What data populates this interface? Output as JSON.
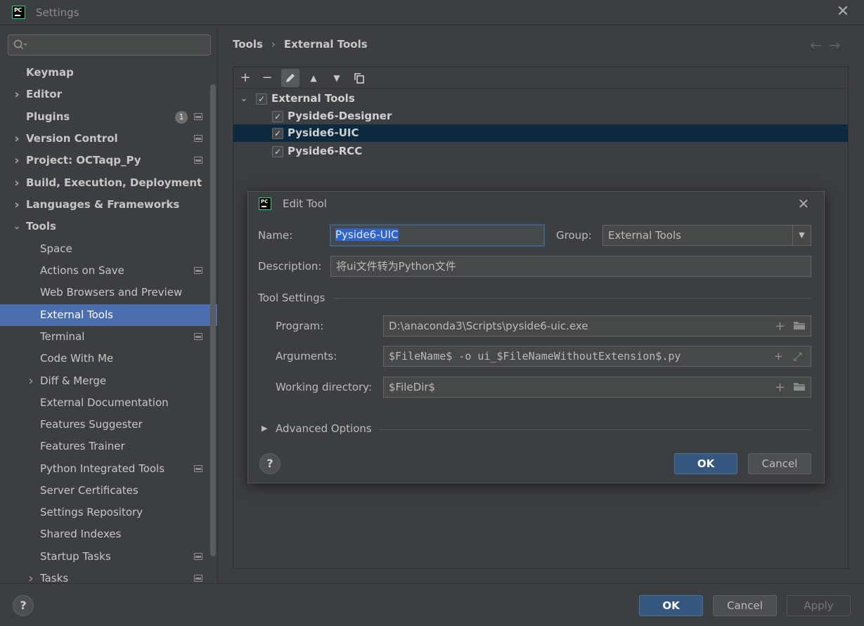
{
  "window": {
    "title": "Settings",
    "close_icon": "close-icon"
  },
  "sidebar": {
    "search": {
      "placeholder": "",
      "value": ""
    },
    "items": [
      {
        "label": "Keymap",
        "level": 0,
        "expandable": false
      },
      {
        "label": "Editor",
        "level": 0,
        "expandable": true,
        "expanded": false
      },
      {
        "label": "Plugins",
        "level": 0,
        "expandable": false,
        "badge": "1"
      },
      {
        "label": "Version Control",
        "level": 0,
        "expandable": true,
        "expanded": false
      },
      {
        "label": "Project: OCTaqp_Py",
        "level": 0,
        "expandable": true,
        "expanded": false
      },
      {
        "label": "Build, Execution, Deployment",
        "level": 0,
        "expandable": true,
        "expanded": false
      },
      {
        "label": "Languages & Frameworks",
        "level": 0,
        "expandable": true,
        "expanded": false
      },
      {
        "label": "Tools",
        "level": 0,
        "expandable": true,
        "expanded": true
      },
      {
        "label": "Space",
        "level": 1
      },
      {
        "label": "Actions on Save",
        "level": 1
      },
      {
        "label": "Web Browsers and Preview",
        "level": 1
      },
      {
        "label": "External Tools",
        "level": 1,
        "selected": true
      },
      {
        "label": "Terminal",
        "level": 1
      },
      {
        "label": "Code With Me",
        "level": 1
      },
      {
        "label": "Diff & Merge",
        "level": 1,
        "expandable": true
      },
      {
        "label": "External Documentation",
        "level": 1
      },
      {
        "label": "Features Suggester",
        "level": 1
      },
      {
        "label": "Features Trainer",
        "level": 1
      },
      {
        "label": "Python Integrated Tools",
        "level": 1
      },
      {
        "label": "Server Certificates",
        "level": 1
      },
      {
        "label": "Settings Repository",
        "level": 1
      },
      {
        "label": "Shared Indexes",
        "level": 1
      },
      {
        "label": "Startup Tasks",
        "level": 1
      },
      {
        "label": "Tasks",
        "level": 1,
        "expandable": true
      }
    ]
  },
  "breadcrumb": {
    "parent": "Tools",
    "separator": "›",
    "current": "External Tools"
  },
  "nav": {
    "back_icon": "back-arrow-icon",
    "forward_icon": "forward-arrow-icon"
  },
  "toolbar": {
    "buttons": [
      "add-icon",
      "remove-icon",
      "edit-icon",
      "move-up-icon",
      "move-down-icon",
      "copy-icon"
    ]
  },
  "tools_tree": {
    "group": {
      "label": "External Tools",
      "checked": true,
      "expanded": true
    },
    "items": [
      {
        "label": "Pyside6-Designer",
        "checked": true,
        "selected": false
      },
      {
        "label": "Pyside6-UIC",
        "checked": true,
        "selected": true
      },
      {
        "label": "Pyside6-RCC",
        "checked": true,
        "selected": false
      }
    ]
  },
  "edit_tool": {
    "title": "Edit Tool",
    "name_label": "Name:",
    "name_value": "Pyside6-UIC",
    "group_label": "Group:",
    "group_value": "External Tools",
    "description_label": "Description:",
    "description_value": "将ui文件转为Python文件",
    "tool_settings_label": "Tool Settings",
    "program_label": "Program:",
    "program_value": "D:\\anaconda3\\Scripts\\pyside6-uic.exe",
    "arguments_label": "Arguments:",
    "arguments_value": "$FileName$ -o ui_$FileNameWithoutExtension$.py",
    "working_dir_label": "Working directory:",
    "working_dir_value": "$FileDir$",
    "advanced_label": "Advanced Options",
    "ok_label": "OK",
    "cancel_label": "Cancel",
    "help_label": "?"
  },
  "footer": {
    "help_label": "?",
    "ok_label": "OK",
    "cancel_label": "Cancel",
    "apply_label": "Apply"
  },
  "colors": {
    "background": "#3c3f41",
    "selection": "#4b6eaf",
    "tree_selection": "#0d293e",
    "primary_button": "#365880",
    "text": "#bbbbbb"
  }
}
